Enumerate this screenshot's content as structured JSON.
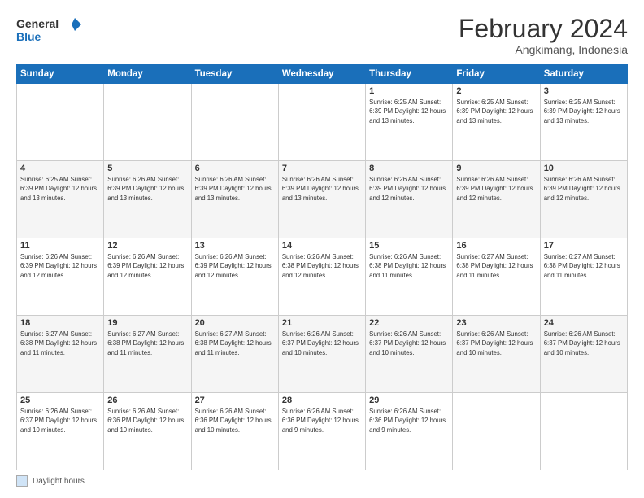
{
  "header": {
    "logo_line1": "General",
    "logo_line2": "Blue",
    "main_title": "February 2024",
    "subtitle": "Angkimang, Indonesia"
  },
  "calendar": {
    "days_of_week": [
      "Sunday",
      "Monday",
      "Tuesday",
      "Wednesday",
      "Thursday",
      "Friday",
      "Saturday"
    ],
    "weeks": [
      [
        {
          "day": "",
          "info": ""
        },
        {
          "day": "",
          "info": ""
        },
        {
          "day": "",
          "info": ""
        },
        {
          "day": "",
          "info": ""
        },
        {
          "day": "1",
          "info": "Sunrise: 6:25 AM\nSunset: 6:39 PM\nDaylight: 12 hours\nand 13 minutes."
        },
        {
          "day": "2",
          "info": "Sunrise: 6:25 AM\nSunset: 6:39 PM\nDaylight: 12 hours\nand 13 minutes."
        },
        {
          "day": "3",
          "info": "Sunrise: 6:25 AM\nSunset: 6:39 PM\nDaylight: 12 hours\nand 13 minutes."
        }
      ],
      [
        {
          "day": "4",
          "info": "Sunrise: 6:25 AM\nSunset: 6:39 PM\nDaylight: 12 hours\nand 13 minutes."
        },
        {
          "day": "5",
          "info": "Sunrise: 6:26 AM\nSunset: 6:39 PM\nDaylight: 12 hours\nand 13 minutes."
        },
        {
          "day": "6",
          "info": "Sunrise: 6:26 AM\nSunset: 6:39 PM\nDaylight: 12 hours\nand 13 minutes."
        },
        {
          "day": "7",
          "info": "Sunrise: 6:26 AM\nSunset: 6:39 PM\nDaylight: 12 hours\nand 13 minutes."
        },
        {
          "day": "8",
          "info": "Sunrise: 6:26 AM\nSunset: 6:39 PM\nDaylight: 12 hours\nand 12 minutes."
        },
        {
          "day": "9",
          "info": "Sunrise: 6:26 AM\nSunset: 6:39 PM\nDaylight: 12 hours\nand 12 minutes."
        },
        {
          "day": "10",
          "info": "Sunrise: 6:26 AM\nSunset: 6:39 PM\nDaylight: 12 hours\nand 12 minutes."
        }
      ],
      [
        {
          "day": "11",
          "info": "Sunrise: 6:26 AM\nSunset: 6:39 PM\nDaylight: 12 hours\nand 12 minutes."
        },
        {
          "day": "12",
          "info": "Sunrise: 6:26 AM\nSunset: 6:39 PM\nDaylight: 12 hours\nand 12 minutes."
        },
        {
          "day": "13",
          "info": "Sunrise: 6:26 AM\nSunset: 6:39 PM\nDaylight: 12 hours\nand 12 minutes."
        },
        {
          "day": "14",
          "info": "Sunrise: 6:26 AM\nSunset: 6:38 PM\nDaylight: 12 hours\nand 12 minutes."
        },
        {
          "day": "15",
          "info": "Sunrise: 6:26 AM\nSunset: 6:38 PM\nDaylight: 12 hours\nand 11 minutes."
        },
        {
          "day": "16",
          "info": "Sunrise: 6:27 AM\nSunset: 6:38 PM\nDaylight: 12 hours\nand 11 minutes."
        },
        {
          "day": "17",
          "info": "Sunrise: 6:27 AM\nSunset: 6:38 PM\nDaylight: 12 hours\nand 11 minutes."
        }
      ],
      [
        {
          "day": "18",
          "info": "Sunrise: 6:27 AM\nSunset: 6:38 PM\nDaylight: 12 hours\nand 11 minutes."
        },
        {
          "day": "19",
          "info": "Sunrise: 6:27 AM\nSunset: 6:38 PM\nDaylight: 12 hours\nand 11 minutes."
        },
        {
          "day": "20",
          "info": "Sunrise: 6:27 AM\nSunset: 6:38 PM\nDaylight: 12 hours\nand 11 minutes."
        },
        {
          "day": "21",
          "info": "Sunrise: 6:26 AM\nSunset: 6:37 PM\nDaylight: 12 hours\nand 10 minutes."
        },
        {
          "day": "22",
          "info": "Sunrise: 6:26 AM\nSunset: 6:37 PM\nDaylight: 12 hours\nand 10 minutes."
        },
        {
          "day": "23",
          "info": "Sunrise: 6:26 AM\nSunset: 6:37 PM\nDaylight: 12 hours\nand 10 minutes."
        },
        {
          "day": "24",
          "info": "Sunrise: 6:26 AM\nSunset: 6:37 PM\nDaylight: 12 hours\nand 10 minutes."
        }
      ],
      [
        {
          "day": "25",
          "info": "Sunrise: 6:26 AM\nSunset: 6:37 PM\nDaylight: 12 hours\nand 10 minutes."
        },
        {
          "day": "26",
          "info": "Sunrise: 6:26 AM\nSunset: 6:36 PM\nDaylight: 12 hours\nand 10 minutes."
        },
        {
          "day": "27",
          "info": "Sunrise: 6:26 AM\nSunset: 6:36 PM\nDaylight: 12 hours\nand 10 minutes."
        },
        {
          "day": "28",
          "info": "Sunrise: 6:26 AM\nSunset: 6:36 PM\nDaylight: 12 hours\nand 9 minutes."
        },
        {
          "day": "29",
          "info": "Sunrise: 6:26 AM\nSunset: 6:36 PM\nDaylight: 12 hours\nand 9 minutes."
        },
        {
          "day": "",
          "info": ""
        },
        {
          "day": "",
          "info": ""
        }
      ]
    ]
  },
  "footer": {
    "legend_label": "Daylight hours"
  }
}
